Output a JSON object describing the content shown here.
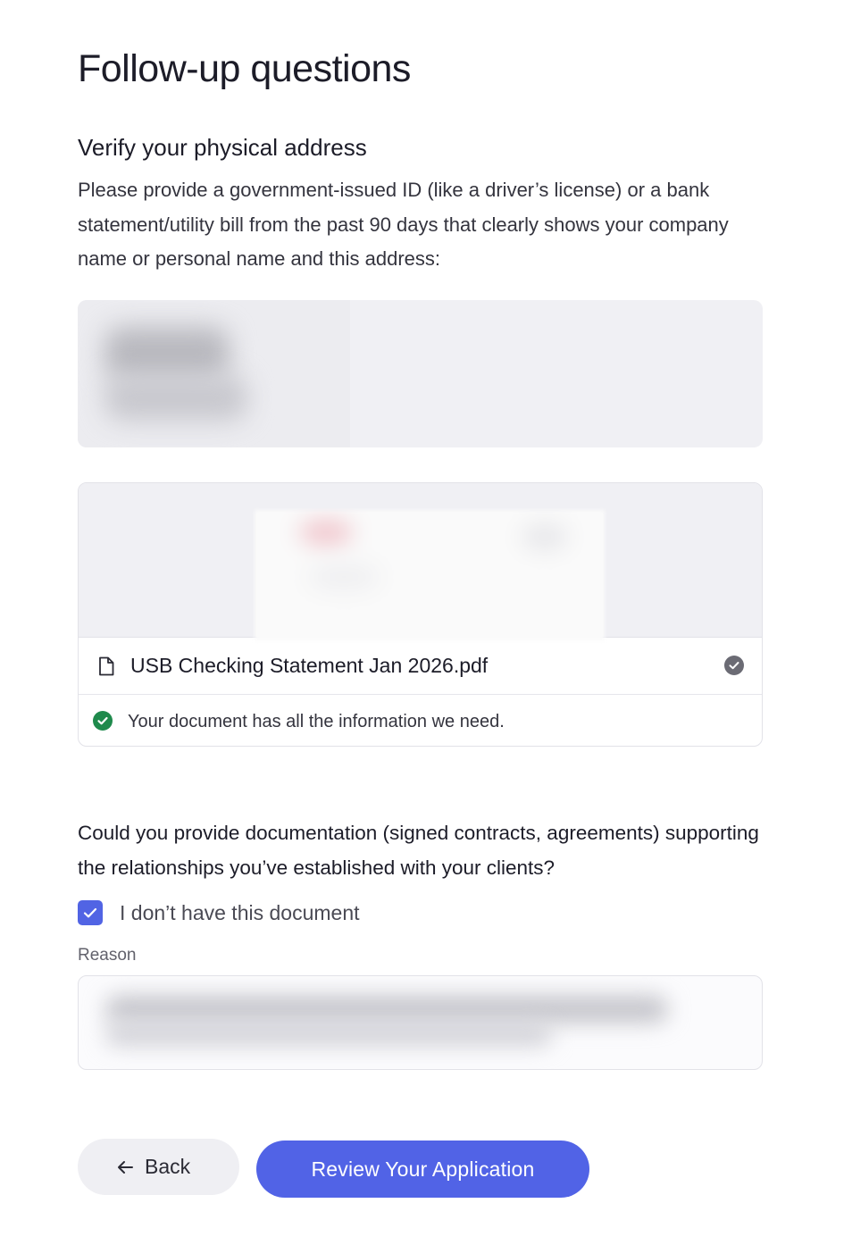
{
  "page": {
    "title": "Follow-up questions"
  },
  "address_section": {
    "title": "Verify your physical address",
    "description": "Please provide a government-issued ID (like a driver’s license) or a bank statement/utility bill from the past 90 days that clearly shows your company name or personal name and this address:"
  },
  "document": {
    "file_name": "USB Checking Statement Jan 2026.pdf",
    "status_message": "Your document has all the information we need.",
    "icons": {
      "file": "file-icon",
      "uploaded": "check-circle-icon",
      "verified": "check-circle-icon"
    }
  },
  "relationships_section": {
    "question": "Could you provide documentation (signed contracts, agreements) supporting the relationships you’ve established with your clients?",
    "no_document_label": "I don’t have this document",
    "no_document_checked": true,
    "reason_label": "Reason"
  },
  "actions": {
    "back_label": "Back",
    "review_label": "Review Your Application"
  },
  "colors": {
    "primary": "#5163e6",
    "success": "#1f8a4c",
    "text": "#1c1c28",
    "muted_surface": "#f0f0f4"
  }
}
